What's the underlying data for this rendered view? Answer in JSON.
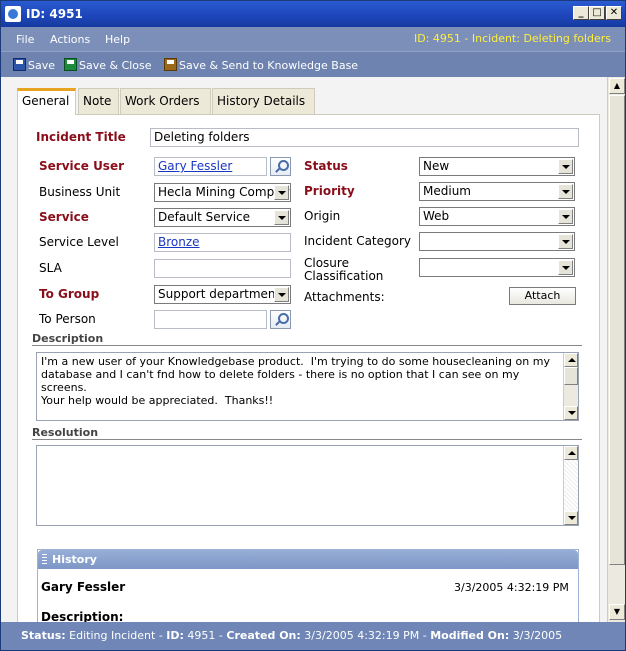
{
  "window": {
    "title": "ID: 4951",
    "min": "_",
    "max": "□",
    "close": "✕"
  },
  "menu": {
    "file": "File",
    "actions": "Actions",
    "help": "Help",
    "breadcrumb": "ID: 4951 - Incident: Deleting folders"
  },
  "toolbar": {
    "save": "Save",
    "save_close": "Save & Close",
    "save_send": "Save & Send to Knowledge Base"
  },
  "tabs": [
    "General",
    "Note",
    "Work Orders",
    "History Details"
  ],
  "form": {
    "incident_title_label": "Incident Title",
    "incident_title_value": "Deleting folders",
    "service_user_label": "Service User",
    "service_user_value": "Gary  Fessler",
    "business_unit_label": "Business Unit",
    "business_unit_value": "Hecla Mining Company",
    "service_label": "Service",
    "service_value": "Default Service",
    "service_level_label": "Service Level",
    "service_level_value": "Bronze",
    "sla_label": "SLA",
    "sla_value": "",
    "to_group_label": "To Group",
    "to_group_value": "Support department",
    "to_person_label": "To Person",
    "to_person_value": "",
    "status_label": "Status",
    "status_value": "New",
    "priority_label": "Priority",
    "priority_value": "Medium",
    "origin_label": "Origin",
    "origin_value": "Web",
    "incident_category_label": "Incident Category",
    "incident_category_value": "",
    "closure_label_1": "Closure",
    "closure_label_2": "Classification",
    "closure_value": "",
    "attachments_label": "Attachments:",
    "attach_button": "Attach"
  },
  "description": {
    "label": "Description",
    "text": "I'm a new user of your Knowledgebase product.  I'm trying to do some housecleaning on my\ndatabase and I can't fnd how to delete folders - there is no option that I can see on my screens.\nYour help would be appreciated.  Thanks!!"
  },
  "resolution": {
    "label": "Resolution",
    "text": ""
  },
  "history": {
    "header": "History",
    "name": "Gary Fessler",
    "timestamp": "3/3/2005 4:32:19 PM",
    "description_label": "Description:"
  },
  "status_bar": {
    "status_label": "Status:",
    "status_value": "Editing Incident",
    "sep": "-",
    "id_label": "ID:",
    "id_value": "4951",
    "created_label": "Created On:",
    "created_value": "3/3/2005 4:32:19 PM",
    "modified_label": "Modified On:",
    "modified_value": "3/3/2005"
  }
}
